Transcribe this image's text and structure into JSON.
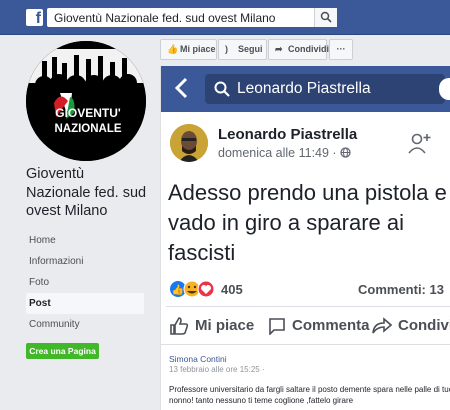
{
  "topbar": {
    "logo_letter": "f",
    "search_value": "Gioventù Nazionale fed. sud ovest Milano"
  },
  "sidebar": {
    "page_name": "Gioventù Nazionale fed. sud ovest Milano",
    "logo_text_line1": "GIOVENTU'",
    "logo_text_line2": "NAZIONALE",
    "items": [
      {
        "label": "Home"
      },
      {
        "label": "Informazioni"
      },
      {
        "label": "Foto"
      },
      {
        "label": "Post",
        "active": true
      },
      {
        "label": "Community"
      }
    ],
    "create_label": "Crea una Pagina"
  },
  "actions": {
    "like": "Mi piace",
    "follow": "Segui",
    "share": "Condividi",
    "more": "···"
  },
  "post": {
    "search_name": "Leonardo Piastrella",
    "author": "Leonardo Piastrella",
    "time": "domenica alle 11:49 ·",
    "text": "Adesso prendo una pistola e vado in giro a sparare ai fascisti",
    "reaction_count": "405",
    "comments": "Commenti: 13",
    "like_label": "Mi piace",
    "comment_label": "Commenta",
    "share_label": "Condivi"
  },
  "comment": {
    "author": "Simona Contini",
    "date": "13 febbraio alle ore 15:25 ·",
    "text": "Professore universitario da fargli saltare il posto demente spara nelle palle di tuo nonno! tanto nessuno ti teme coglione ,fattelo girare"
  },
  "colors": {
    "facebook_blue": "#3b5998",
    "create_green": "#42b72a",
    "link_blue": "#385898"
  }
}
